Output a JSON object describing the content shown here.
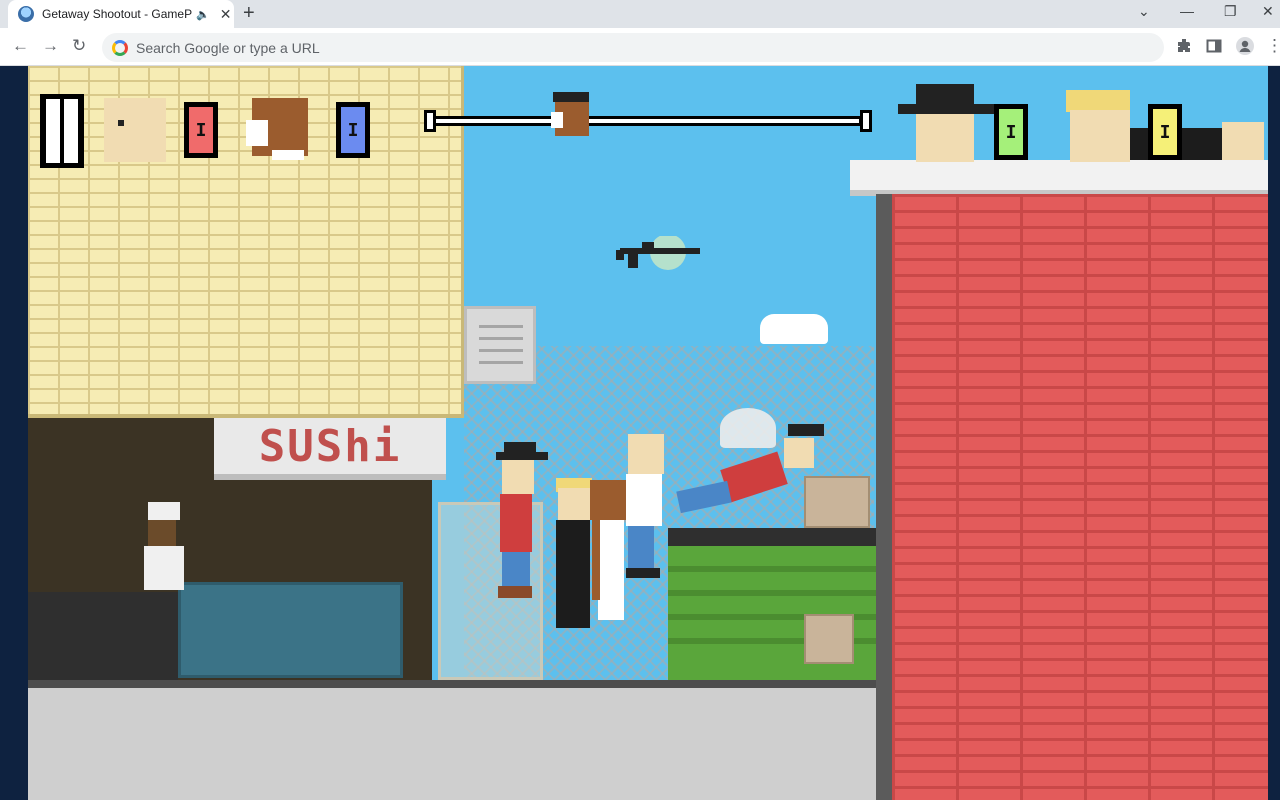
{
  "browser": {
    "tab_title": "Getaway Shootout - GamePl",
    "tab_audio_icon": "speaker-icon",
    "tab_close_symbol": "✕",
    "new_tab_symbol": "+",
    "omnibox_placeholder": "Search Google or type a URL",
    "window_controls": {
      "chevron": "⌄",
      "minimize": "—",
      "restore": "❐",
      "close": "✕"
    }
  },
  "game": {
    "sign_text": "SUShi",
    "hud": {
      "left_team": [
        {
          "name": "player-1",
          "ammo_label": "I",
          "badge_color": "#f06b6b"
        },
        {
          "name": "player-2",
          "ammo_label": "I",
          "badge_color": "#6b8bf0"
        }
      ],
      "right_team": [
        {
          "name": "player-3",
          "ammo_label": "I",
          "badge_color": "#a5f07a"
        },
        {
          "name": "player-4",
          "ammo_label": "I",
          "badge_color": "#f5f078"
        }
      ],
      "race_progress": 0.31
    },
    "colors": {
      "sky": "#5cc0ee",
      "yellow_brick": "#f6ecb4",
      "red_brick": "#e35b5b",
      "dumpster": "#5aa63b"
    }
  }
}
